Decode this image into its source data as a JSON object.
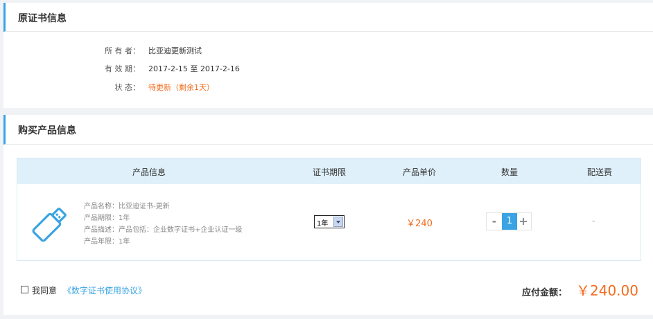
{
  "cert_section": {
    "title": "原证书信息",
    "owner_label": "所 有 者：",
    "owner_value": "比亚迪更新测试",
    "validity_label": "有 效 期：",
    "validity_value": "2017-2-15 至 2017-2-16",
    "status_label": "状 态：",
    "status_value": "待更新（剩余1天）"
  },
  "purchase_section": {
    "title": "购买产品信息",
    "columns": [
      "产品信息",
      "证书期限",
      "产品单价",
      "数量",
      "配送费"
    ],
    "product": {
      "icon": "usb-key-icon",
      "name": "产品名称：比亚迪证书-更新",
      "period": "产品期限：1年",
      "description": "产品描述：产品包括：企业数字证书+企业认证一级",
      "years": "产品年限：1年",
      "period_select": "1年",
      "unit_price": "￥240",
      "quantity": "1",
      "minus": "-",
      "plus": "+",
      "shipping": "-"
    }
  },
  "footer": {
    "agree_text": "我同意",
    "agree_link": "《数字证书使用协议》",
    "total_label": "应付金额：",
    "total_amount": "￥240.00"
  },
  "colors": {
    "accent_blue": "#3aa3e3",
    "price_orange": "#f26b1d",
    "table_header_bg": "#dff0fb"
  }
}
